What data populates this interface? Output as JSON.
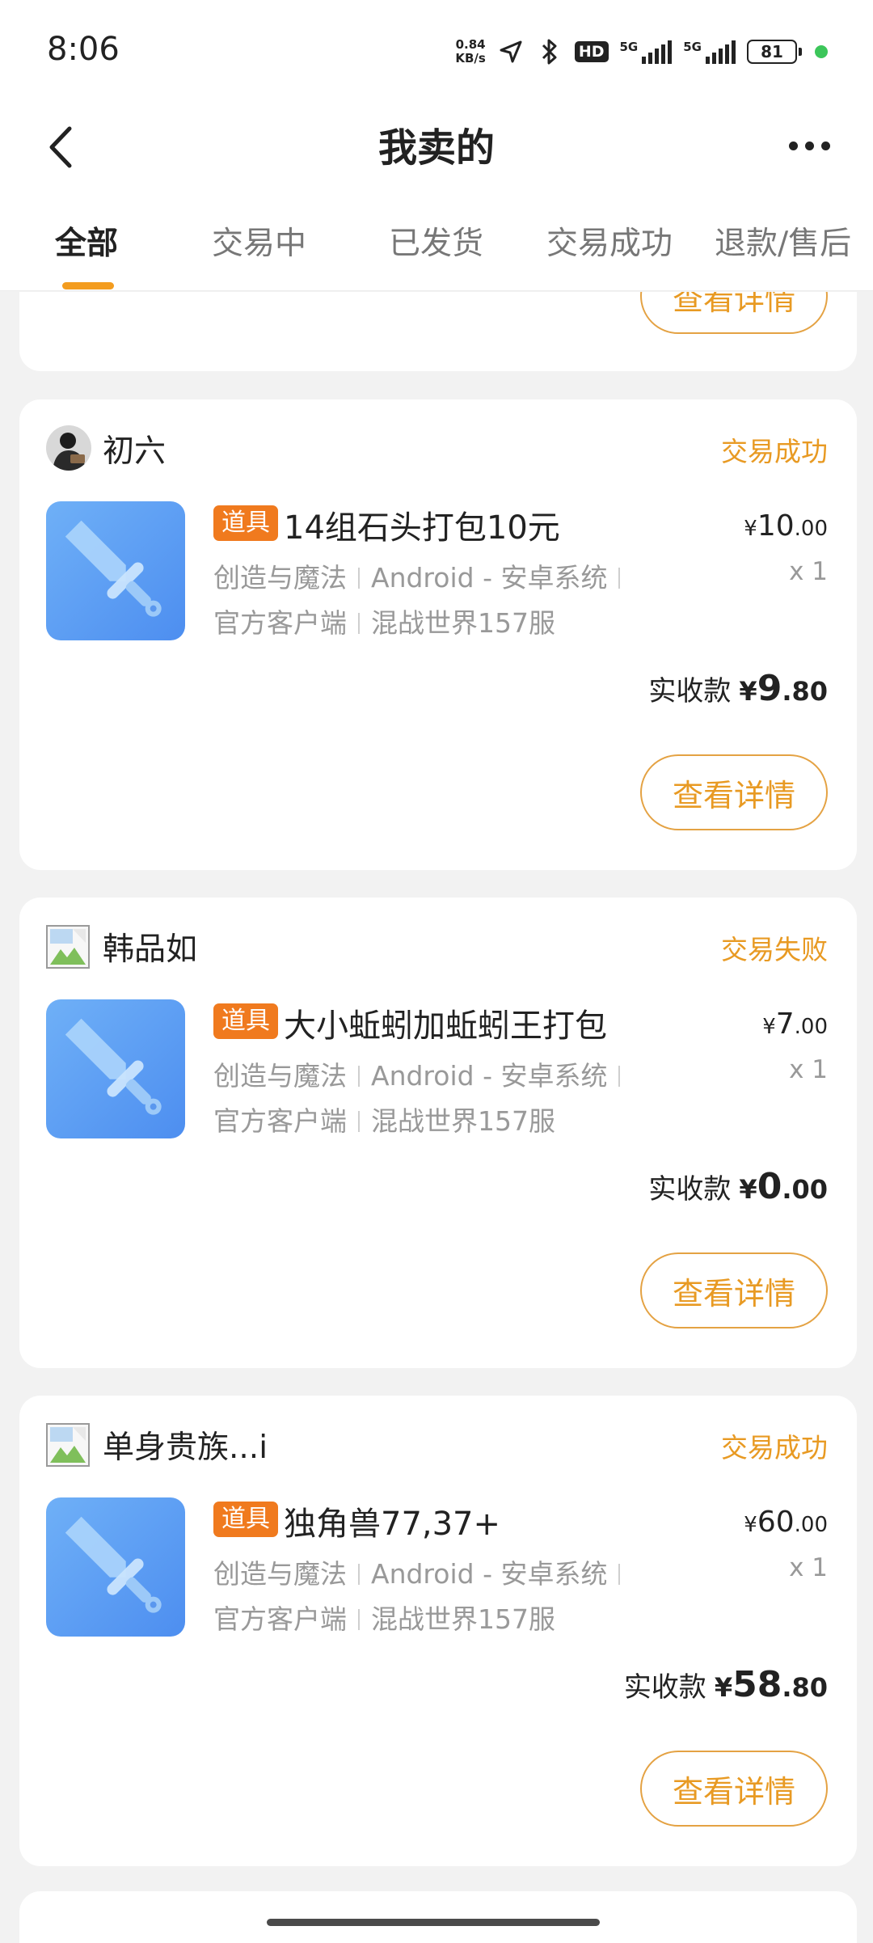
{
  "status_bar": {
    "time": "8:06",
    "net_speed_value": "0.84",
    "net_speed_unit": "KB/s",
    "hd_label": "HD",
    "network_1": "5G",
    "network_2": "5G",
    "battery": "81"
  },
  "header": {
    "title": "我卖的"
  },
  "tabs": [
    {
      "label": "全部",
      "active": true
    },
    {
      "label": "交易中",
      "active": false
    },
    {
      "label": "已发货",
      "active": false
    },
    {
      "label": "交易成功",
      "active": false
    },
    {
      "label": "退款/售后",
      "active": false
    }
  ],
  "partial_card": {
    "detail_label": "查看详情"
  },
  "orders": [
    {
      "seller": "初六",
      "status": "交易成功",
      "tag": "道具",
      "title": "14组石头打包10元",
      "meta1": [
        "创造与魔法",
        "Android - 安卓系统"
      ],
      "meta2": [
        "官方客户端",
        "混战世界157服"
      ],
      "price_symbol": "¥",
      "price_int": "10",
      "price_dec": ".00",
      "qty": "x 1",
      "received_label": "实收款",
      "received_symbol": "¥",
      "received_int": "9",
      "received_dec": ".80",
      "detail_label": "查看详情"
    },
    {
      "seller": "韩品如",
      "status": "交易失败",
      "tag": "道具",
      "title": "大小蚯蚓加蚯蚓王打包",
      "meta1": [
        "创造与魔法",
        "Android - 安卓系统"
      ],
      "meta2": [
        "官方客户端",
        "混战世界157服"
      ],
      "price_symbol": "¥",
      "price_int": "7",
      "price_dec": ".00",
      "qty": "x 1",
      "received_label": "实收款",
      "received_symbol": "¥",
      "received_int": "0",
      "received_dec": ".00",
      "detail_label": "查看详情"
    },
    {
      "seller": "单身贵族...i",
      "status": "交易成功",
      "tag": "道具",
      "title": "独角兽77,37+",
      "meta1": [
        "创造与魔法",
        "Android - 安卓系统"
      ],
      "meta2": [
        "官方客户端",
        "混战世界157服"
      ],
      "price_symbol": "¥",
      "price_int": "60",
      "price_dec": ".00",
      "qty": "x 1",
      "received_label": "实收款",
      "received_symbol": "¥",
      "received_int": "58",
      "received_dec": ".80",
      "detail_label": "查看详情"
    }
  ],
  "colors": {
    "accent": "#e89a23",
    "tab_indicator": "#f39c1f",
    "tag_bg": "#f07a1e",
    "thumb_blue": "#4d8ef0",
    "background": "#f2f2f2"
  },
  "icons": {
    "back": "chevron-left-icon",
    "more": "more-icon",
    "product": "sword-icon",
    "location": "location-arrow-icon",
    "bluetooth": "bluetooth-icon",
    "broken_avatar": "broken-image-icon"
  }
}
